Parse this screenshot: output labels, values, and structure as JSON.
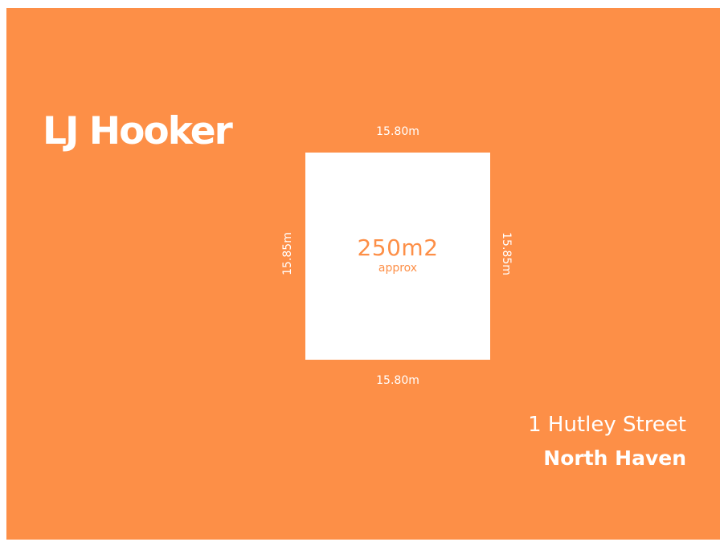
{
  "brand": {
    "logo_text": "LJ Hooker"
  },
  "plot": {
    "area": "250m2",
    "area_note": "approx",
    "top_dimension": "15.80m",
    "bottom_dimension": "15.80m",
    "left_dimension": "15.85m",
    "right_dimension": "15.85m"
  },
  "address": {
    "street": "1 Hutley Street",
    "suburb": "North Haven"
  },
  "colors": {
    "background": "#fd8f47",
    "plot_fill": "#ffffff",
    "text_on_background": "#ffffff",
    "text_on_plot": "#fd8f47"
  }
}
